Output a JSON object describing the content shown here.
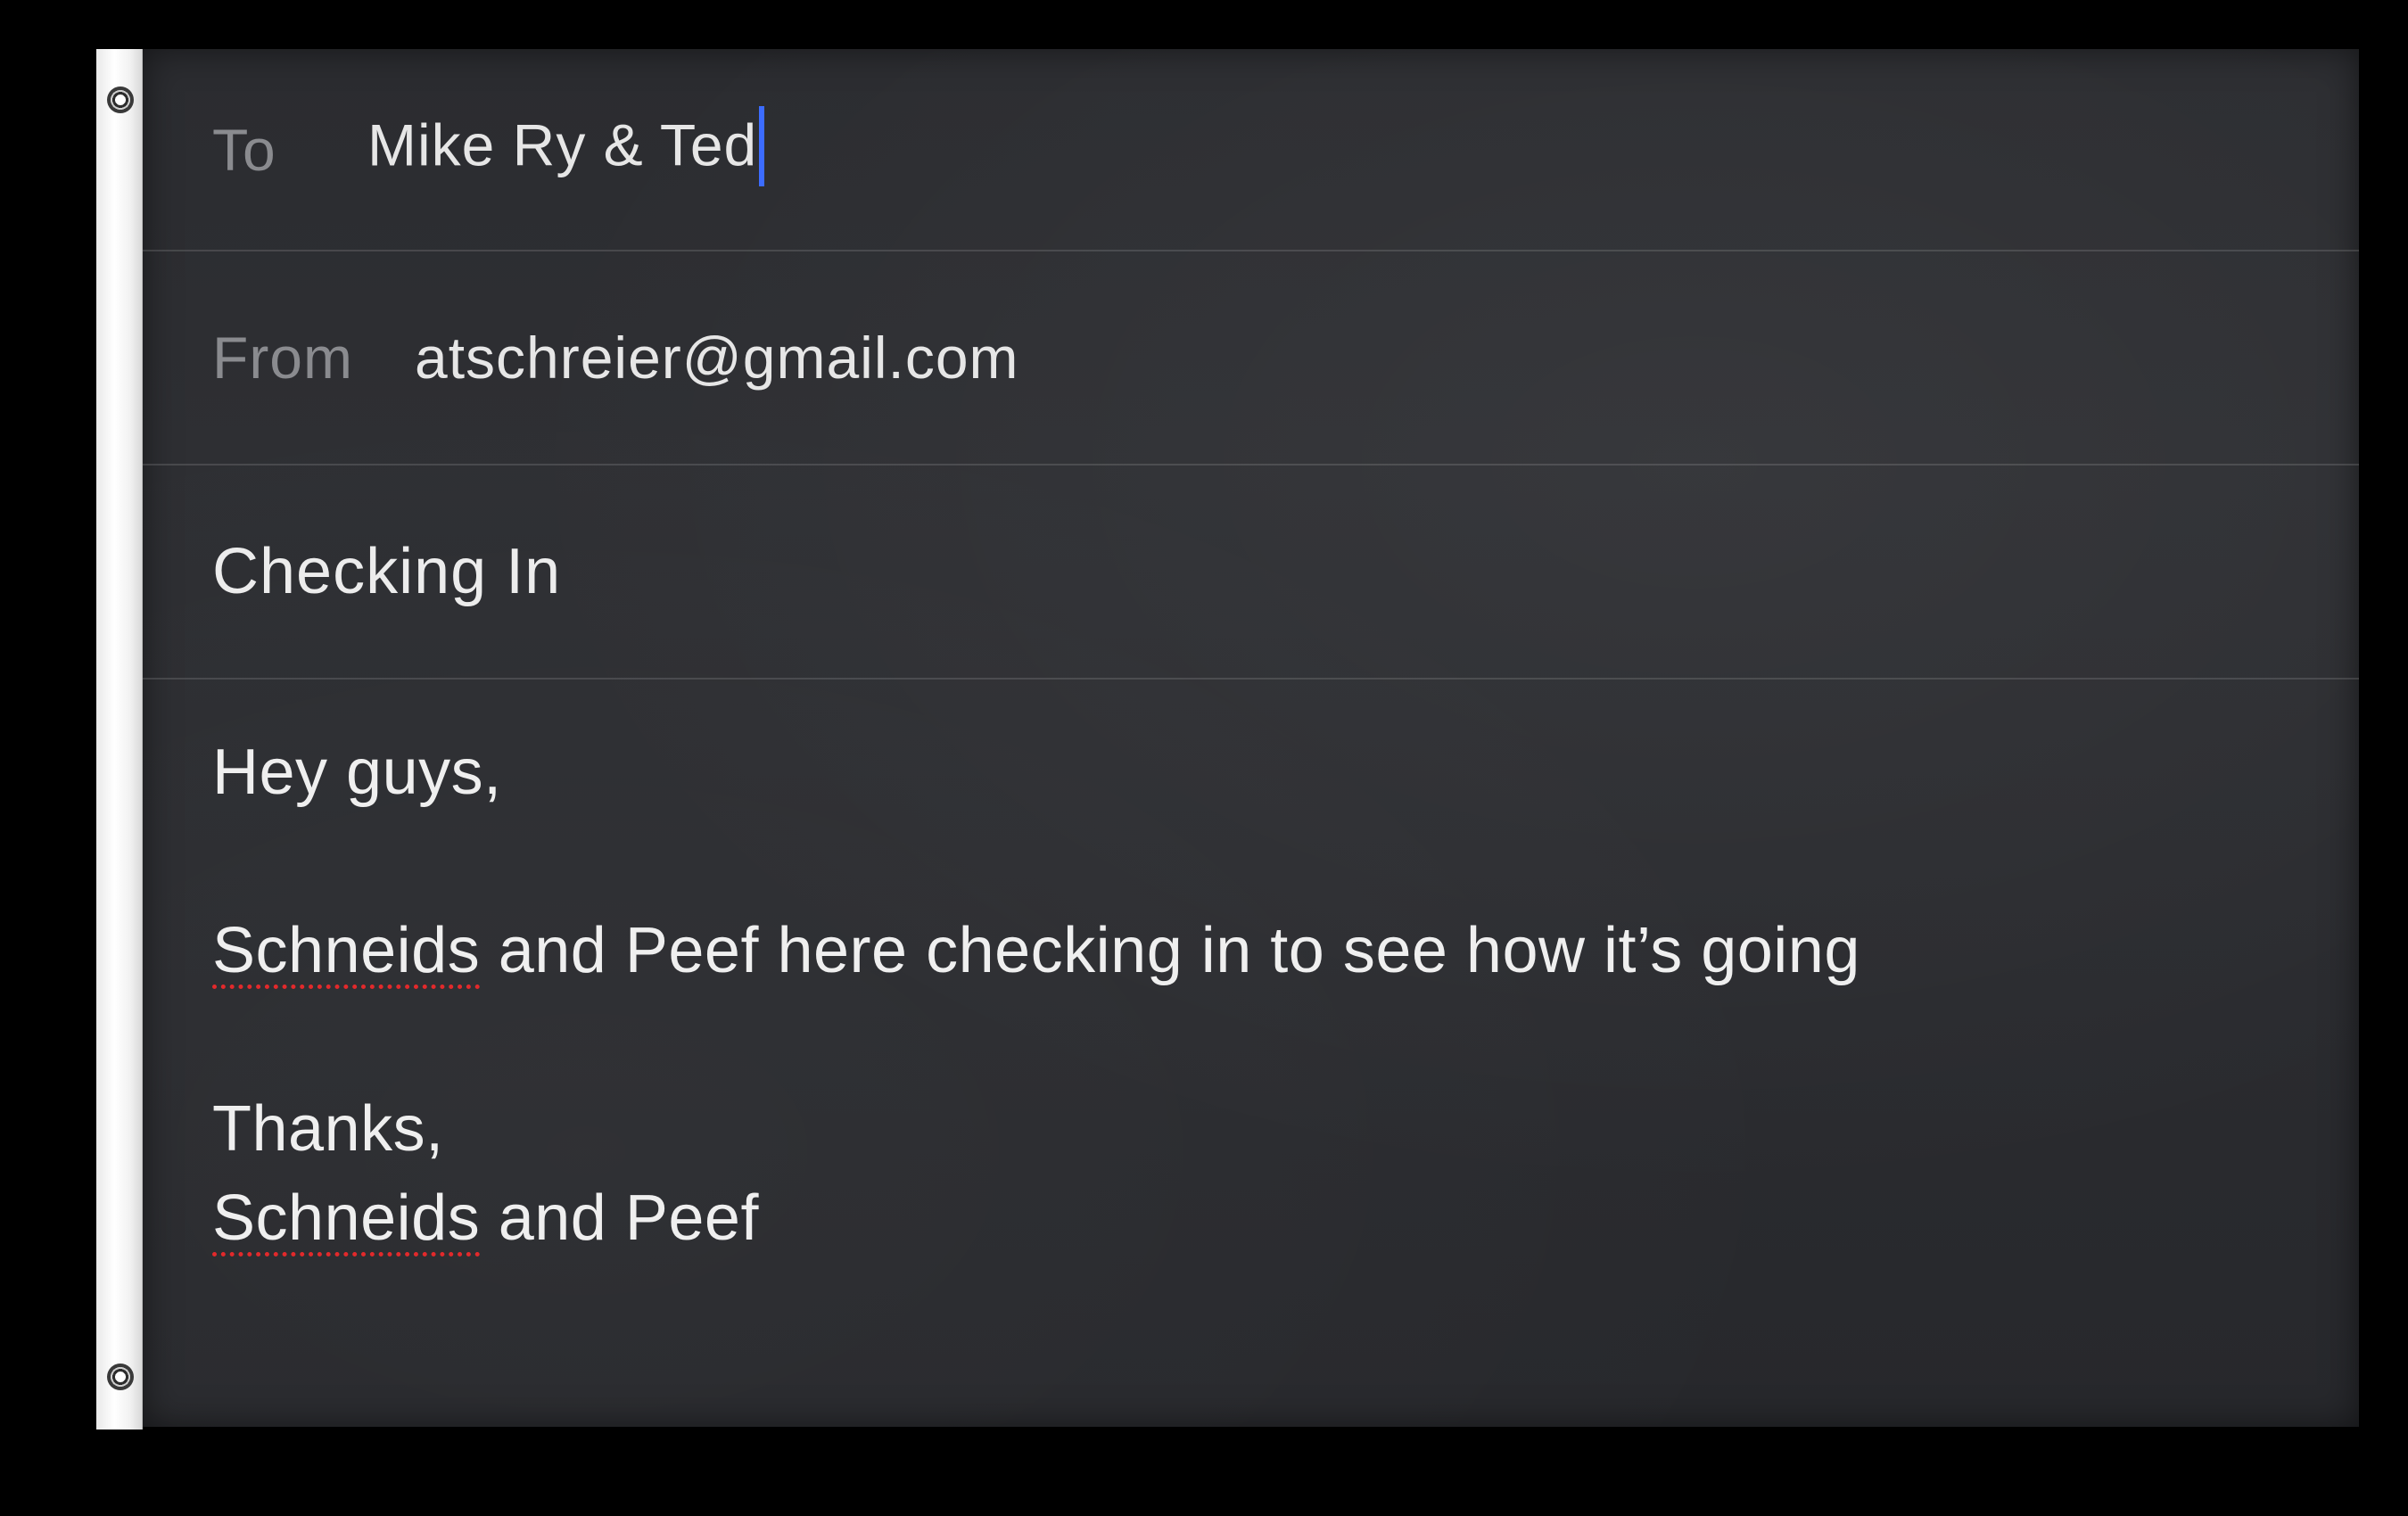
{
  "compose": {
    "to_label": "To",
    "to_value": "Mike Ry & Ted",
    "from_label": "From",
    "from_value": "atschreier@gmail.com",
    "subject": "Checking In"
  },
  "body": {
    "greeting": "Hey guys,",
    "message_word": "Schneids",
    "message_rest": " and Peef here checking in to see how it’s going",
    "closing": "Thanks,",
    "signature_word": "Schneids",
    "signature_rest": " and Peef"
  },
  "colors": {
    "background": "#000000",
    "panel": "#2c2d31",
    "label": "#8a8b8f",
    "text": "#e6e6e6",
    "caret": "#3c6cff",
    "spellcheck": "#e2292b"
  }
}
